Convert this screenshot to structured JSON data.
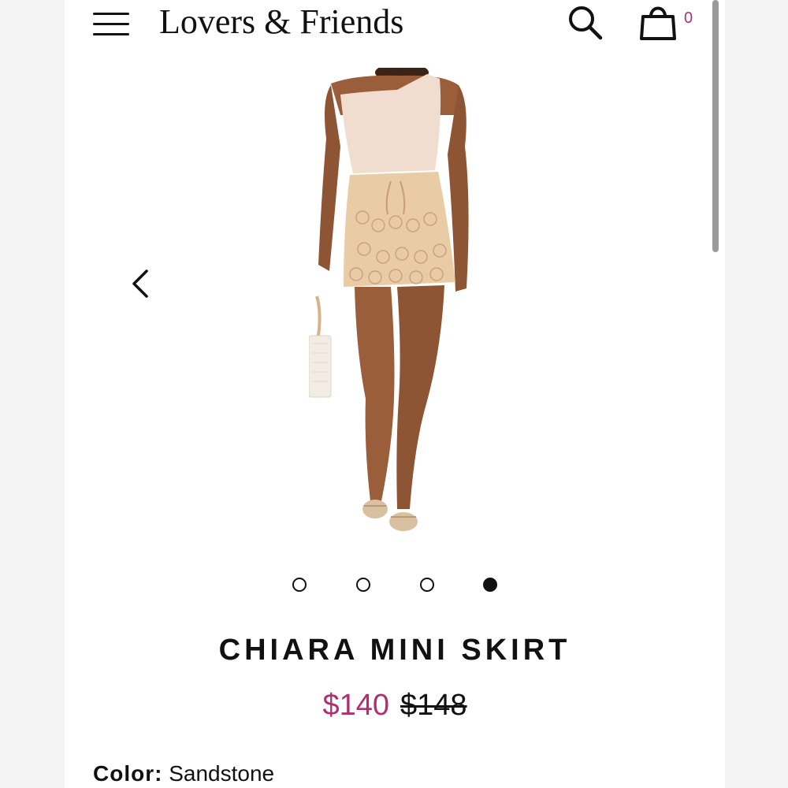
{
  "header": {
    "brand": "Lovers & Friends",
    "cart_count": "0",
    "icons": {
      "menu": "hamburger-menu-icon",
      "search": "search-icon",
      "bag": "shopping-bag-icon"
    }
  },
  "gallery": {
    "prev_icon": "chevron-left-icon",
    "slide_count": 4,
    "active_slide": 4
  },
  "product": {
    "title": "CHIARA MINI SKIRT",
    "sale_price": "$140",
    "original_price": "$148",
    "color_label": "Color:",
    "color_value": "Sandstone"
  },
  "colors": {
    "accent": "#b0306f",
    "text": "#111111"
  }
}
